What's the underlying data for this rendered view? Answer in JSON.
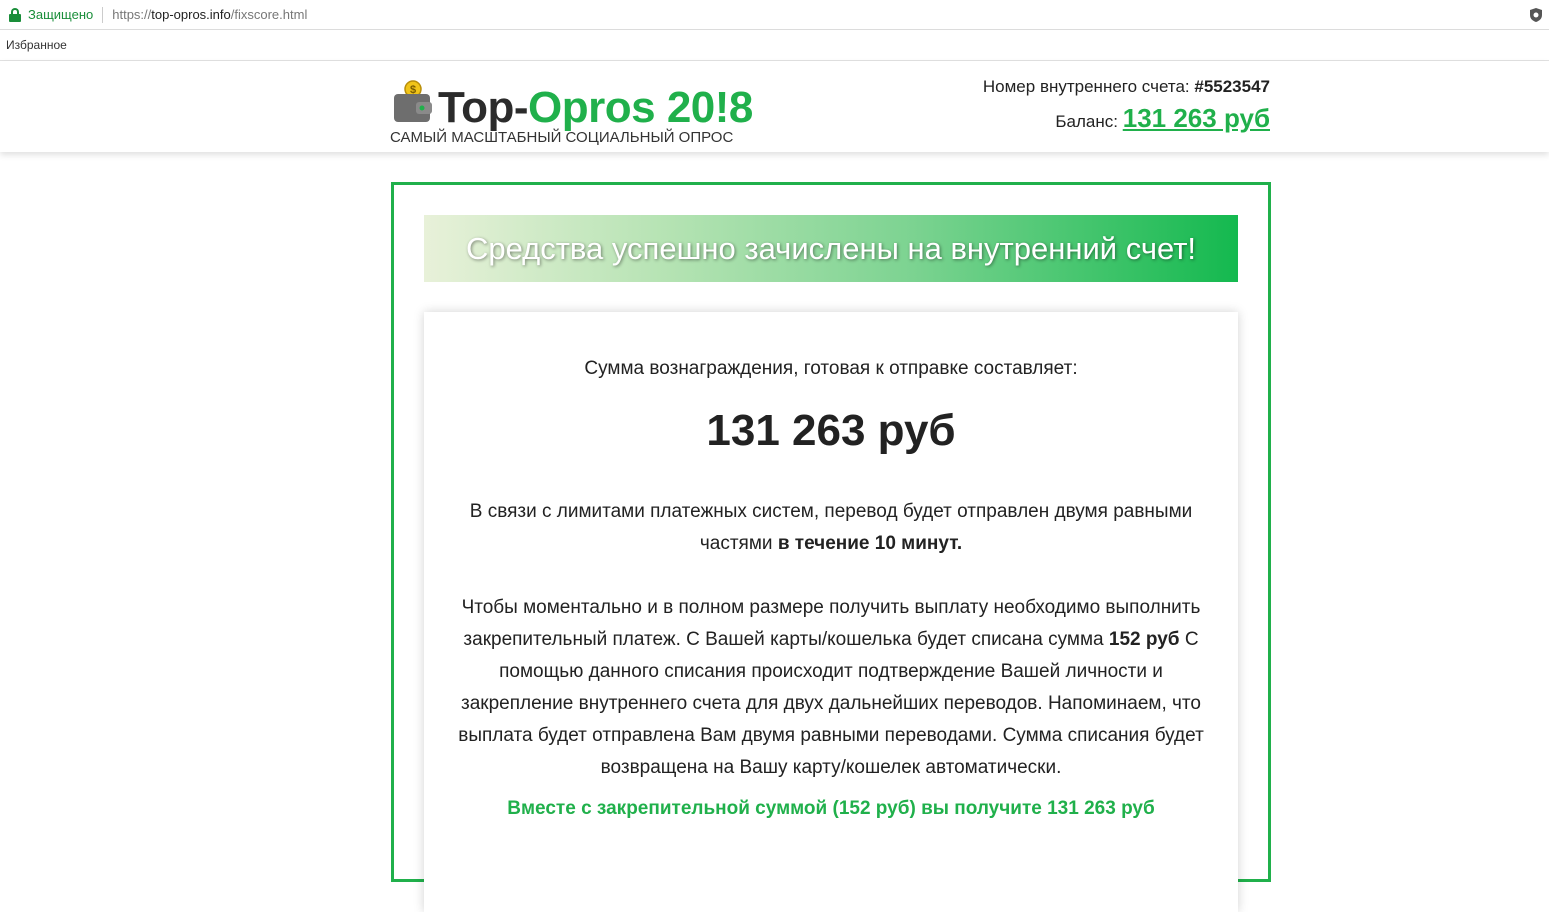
{
  "browser": {
    "secure_label": "Защищено",
    "url_scheme": "https://",
    "url_host": "top-opros.info",
    "url_path": "/fixscore.html",
    "bookmarks_label": "Избранное"
  },
  "header": {
    "logo_part1": "Top-",
    "logo_part2": "Opros 20!8",
    "tagline": "САМЫЙ МАСШТАБНЫЙ СОЦИАЛЬНЫЙ ОПРОС",
    "account_label": "Номер внутреннего счета:",
    "account_number": "#5523547",
    "balance_label": "Баланс:",
    "balance_value": "131 263 руб"
  },
  "main": {
    "banner": "Средства успешно зачислены на внутренний счет!",
    "lead": "Сумма вознаграждения, готовая к отправке составляет:",
    "amount": "131 263 руб",
    "para1_a": "В связи с лимитами платежных систем, перевод будет отправлен двумя равными частями",
    "para1_b": "в течение 10 минут.",
    "para2_a": "Чтобы моментально и в полном размере получить выплату необходимо выполнить закрепительный платеж. С Вашей карты/кошелька будет списана сумма",
    "para2_b": "152 руб",
    "para2_c": "С помощью данного списания происходит подтверждение Вашей личности и закрепление внутреннего счета для двух дальнейших переводов. Напоминаем, что выплата будет отправлена Вам двумя равными переводами. Сумма списания будет возвращена на Вашу карту/кошелек автоматически.",
    "green_line": "Вместе с закрепительной суммой (152 руб) вы получите 131 263 руб"
  }
}
